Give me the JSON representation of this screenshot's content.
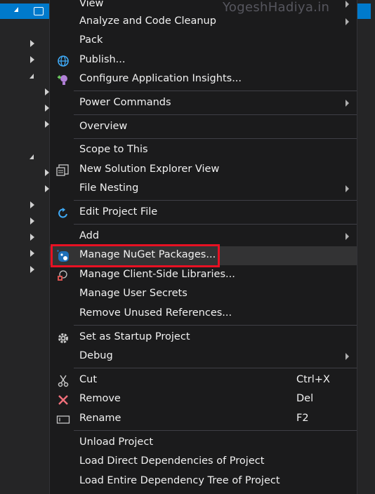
{
  "watermark": "YogeshHadiya.in",
  "menu": {
    "items": [
      {
        "label": "View",
        "submenu": true
      },
      {
        "label": "Analyze and Code Cleanup",
        "submenu": true
      },
      {
        "label": "Pack"
      },
      {
        "label": "Publish...",
        "icon": "globe-icon"
      },
      {
        "label": "Configure Application Insights...",
        "icon": "application-insights-icon"
      },
      {
        "label": "Power Commands",
        "submenu": true
      },
      {
        "label": "Overview"
      },
      {
        "label": "Scope to This"
      },
      {
        "label": "New Solution Explorer View",
        "icon": "new-solution-explorer-view-icon"
      },
      {
        "label": "File Nesting",
        "submenu": true
      },
      {
        "label": "Edit Project File",
        "icon": "edit-project-file-icon"
      },
      {
        "label": "Add",
        "submenu": true
      },
      {
        "label": "Manage NuGet Packages...",
        "icon": "nuget-icon",
        "highlighted": true
      },
      {
        "label": "Manage Client-Side Libraries...",
        "icon": "client-side-libraries-icon"
      },
      {
        "label": "Manage User Secrets"
      },
      {
        "label": "Remove Unused References..."
      },
      {
        "label": "Set as Startup Project",
        "icon": "gear-icon"
      },
      {
        "label": "Debug",
        "submenu": true
      },
      {
        "label": "Cut",
        "shortcut": "Ctrl+X",
        "icon": "scissors-icon"
      },
      {
        "label": "Remove",
        "shortcut": "Del",
        "icon": "close-icon"
      },
      {
        "label": "Rename",
        "shortcut": "F2",
        "icon": "rename-icon"
      },
      {
        "label": "Unload Project"
      },
      {
        "label": "Load Direct Dependencies of Project"
      },
      {
        "label": "Load Entire Dependency Tree of Project"
      }
    ]
  },
  "colors": {
    "menu_background": "#1b1b1c",
    "hover_background": "#333334",
    "highlight_border": "#e81123",
    "selection_blue": "#007acc",
    "text": "#f1f1f1"
  }
}
